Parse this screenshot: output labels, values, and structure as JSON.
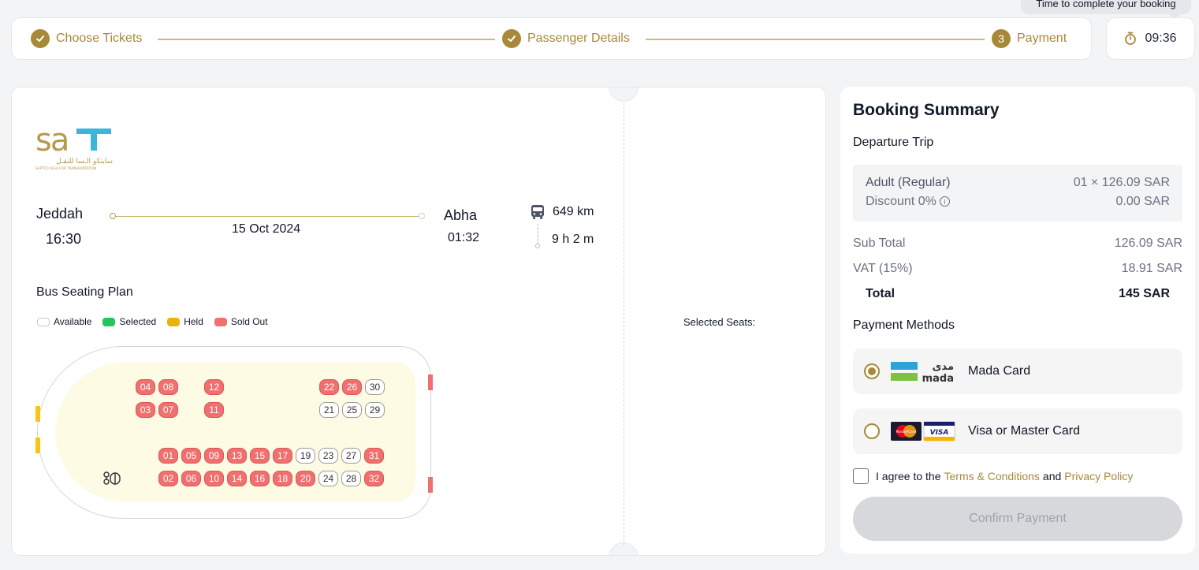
{
  "stepper": {
    "steps": [
      {
        "label": "Choose Tickets",
        "badge": ""
      },
      {
        "label": "Passenger Details",
        "badge": ""
      },
      {
        "label": "Payment",
        "badge": "3"
      }
    ]
  },
  "timer": {
    "tooltip": "Time to complete your booking",
    "value": "09:36",
    "icon": "stopwatch-icon"
  },
  "brand": {
    "logo_text": "SAT",
    "logo_arabic": "سابتكو الـسا للنقـل",
    "logo_sub": "SAPTCO ALSA FOR TRANSPORTATION"
  },
  "trip": {
    "origin": "Jeddah",
    "departure_time": "16:30",
    "destination": "Abha",
    "arrival_time": "01:32",
    "date": "15 Oct 2024",
    "distance": "649 km",
    "duration": "9 h 2 m"
  },
  "seating": {
    "title": "Bus Seating Plan",
    "legend": {
      "available": "Available",
      "selected": "Selected",
      "held": "Held",
      "sold": "Sold Out"
    },
    "selected_seats_label": "Selected Seats:",
    "seats": [
      {
        "n": "04",
        "s": "sold"
      },
      {
        "n": "08",
        "s": "sold"
      },
      {
        "n": "12",
        "s": "sold"
      },
      {
        "n": "22",
        "s": "sold"
      },
      {
        "n": "26",
        "s": "sold"
      },
      {
        "n": "30",
        "s": "available"
      },
      {
        "n": "03",
        "s": "sold"
      },
      {
        "n": "07",
        "s": "sold"
      },
      {
        "n": "11",
        "s": "sold"
      },
      {
        "n": "21",
        "s": "available"
      },
      {
        "n": "25",
        "s": "available"
      },
      {
        "n": "29",
        "s": "available"
      },
      {
        "n": "01",
        "s": "sold"
      },
      {
        "n": "05",
        "s": "sold"
      },
      {
        "n": "09",
        "s": "sold"
      },
      {
        "n": "13",
        "s": "sold"
      },
      {
        "n": "15",
        "s": "sold"
      },
      {
        "n": "17",
        "s": "sold"
      },
      {
        "n": "19",
        "s": "available"
      },
      {
        "n": "23",
        "s": "available"
      },
      {
        "n": "27",
        "s": "available"
      },
      {
        "n": "31",
        "s": "sold"
      },
      {
        "n": "02",
        "s": "sold"
      },
      {
        "n": "06",
        "s": "sold"
      },
      {
        "n": "10",
        "s": "sold"
      },
      {
        "n": "14",
        "s": "sold"
      },
      {
        "n": "16",
        "s": "sold"
      },
      {
        "n": "18",
        "s": "sold"
      },
      {
        "n": "20",
        "s": "sold"
      },
      {
        "n": "24",
        "s": "available"
      },
      {
        "n": "28",
        "s": "available"
      },
      {
        "n": "32",
        "s": "sold"
      }
    ]
  },
  "summary": {
    "title": "Booking Summary",
    "trip_label": "Departure Trip",
    "fare_type": "Adult (Regular)",
    "fare_amount": "01 × 126.09 SAR",
    "discount_label": "Discount 0%",
    "discount_amount": "0.00 SAR",
    "subtotal_label": "Sub Total",
    "subtotal": "126.09 SAR",
    "vat_label": "VAT (15%)",
    "vat": "18.91 SAR",
    "total_label": "Total",
    "total": "145 SAR"
  },
  "payment": {
    "title": "Payment Methods",
    "methods": [
      {
        "label": "Mada Card",
        "selected": true,
        "logo_ar": "مدى",
        "logo_en": "mada"
      },
      {
        "label": "Visa or Master Card",
        "selected": false,
        "logo_mc": "MasterCard",
        "logo_visa": "VISA"
      }
    ],
    "terms_prefix": "I agree to the",
    "terms_link": "Terms & Conditions",
    "terms_and": "and",
    "privacy_link": "Privacy Policy",
    "confirm_label": "Confirm Payment"
  },
  "colors": {
    "accent": "#a8893a",
    "sold": "#f07070",
    "held": "#eab308",
    "selected": "#22c55e"
  }
}
